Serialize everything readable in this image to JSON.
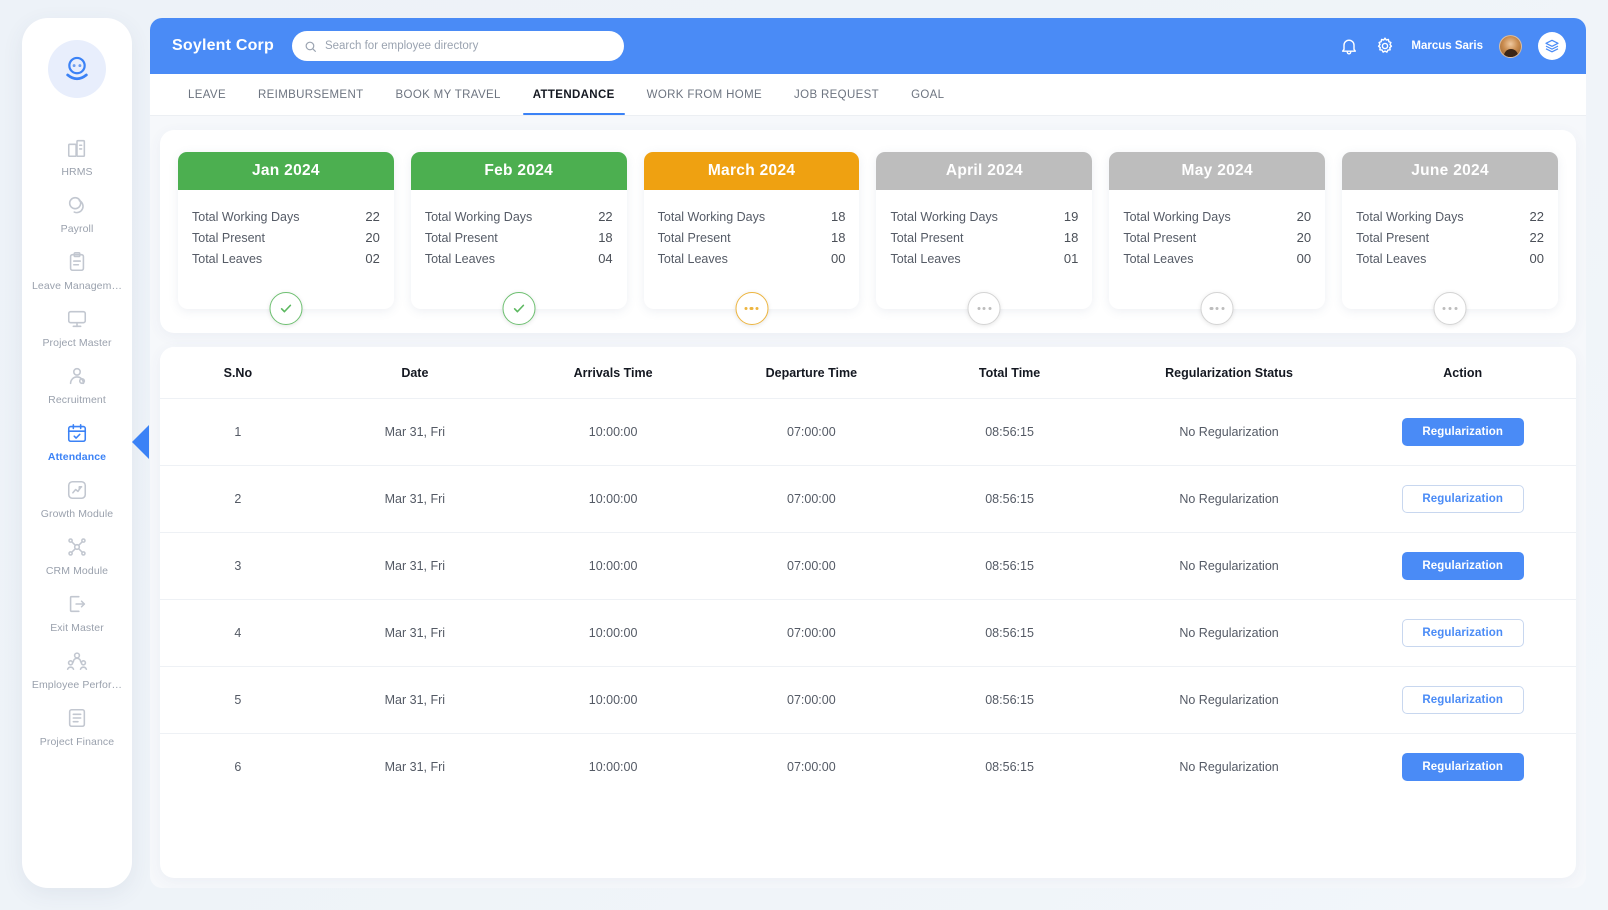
{
  "sidebar": {
    "logo_icon": "robot-avatar-logo",
    "items": [
      {
        "label": "HRMS",
        "icon": "buildings-icon",
        "active": false
      },
      {
        "label": "Payroll",
        "icon": "coins-icon",
        "active": false
      },
      {
        "label": "Leave Managem…",
        "icon": "clipboard-icon",
        "active": false
      },
      {
        "label": "Project Master",
        "icon": "monitor-icon",
        "active": false
      },
      {
        "label": "Recruitment",
        "icon": "user-search-icon",
        "active": false
      },
      {
        "label": "Attendance",
        "icon": "calendar-check-icon",
        "active": true
      },
      {
        "label": "Growth Module",
        "icon": "chart-growth-icon",
        "active": false
      },
      {
        "label": "CRM Module",
        "icon": "network-user-icon",
        "active": false
      },
      {
        "label": "Exit Master",
        "icon": "exit-door-icon",
        "active": false
      },
      {
        "label": "Employee Perfor…",
        "icon": "people-group-icon",
        "active": false
      },
      {
        "label": "Project Finance",
        "icon": "file-finance-icon",
        "active": false
      }
    ]
  },
  "topbar": {
    "brand": "Soylent Corp",
    "search_placeholder": "Search for employee directory",
    "search_value": "",
    "search_icon": "search-icon",
    "bell_icon": "bell-icon",
    "gear_icon": "gear-icon",
    "user_name": "Marcus Saris",
    "avatar_icon": "user-avatar",
    "stack_icon": "layers-icon"
  },
  "tabs": [
    {
      "label": "LEAVE",
      "active": false
    },
    {
      "label": "REIMBURSEMENT",
      "active": false
    },
    {
      "label": "BOOK MY TRAVEL",
      "active": false
    },
    {
      "label": "ATTENDANCE",
      "active": true
    },
    {
      "label": "WORK FROM HOME",
      "active": false
    },
    {
      "label": "JOB REQUEST",
      "active": false
    },
    {
      "label": "GOAL",
      "active": false
    }
  ],
  "month_cards": {
    "labels": {
      "working_days": "Total Working Days",
      "present": "Total Present",
      "leaves": "Total Leaves"
    },
    "items": [
      {
        "month": "Jan 2024",
        "working_days": "22",
        "present": "20",
        "leaves": "02",
        "theme": "green",
        "status_icon": "check-icon",
        "accent": "#4caf50"
      },
      {
        "month": "Feb 2024",
        "working_days": "22",
        "present": "18",
        "leaves": "04",
        "theme": "green",
        "status_icon": "check-icon",
        "accent": "#4caf50"
      },
      {
        "month": "March 2024",
        "working_days": "18",
        "present": "18",
        "leaves": "00",
        "theme": "orange",
        "status_icon": "ellipsis-icon",
        "accent": "#efa111"
      },
      {
        "month": "April 2024",
        "working_days": "19",
        "present": "18",
        "leaves": "01",
        "theme": "grey",
        "status_icon": "ellipsis-icon",
        "accent": "#bdbdbd"
      },
      {
        "month": "May 2024",
        "working_days": "20",
        "present": "20",
        "leaves": "00",
        "theme": "grey",
        "status_icon": "ellipsis-icon",
        "accent": "#bdbdbd"
      },
      {
        "month": "June 2024",
        "working_days": "22",
        "present": "22",
        "leaves": "00",
        "theme": "grey",
        "status_icon": "ellipsis-icon",
        "accent": "#bdbdbd"
      }
    ]
  },
  "table": {
    "headers": [
      "S.No",
      "Date",
      "Arrivals Time",
      "Departure Time",
      "Total Time",
      "Regularization Status",
      "Action"
    ],
    "rows": [
      {
        "sno": "1",
        "date": "Mar 31, Fri",
        "arrival": "10:00:00",
        "departure": "07:00:00",
        "total": "08:56:15",
        "status": "No Regularization",
        "action": "Regularization",
        "action_style": "filled"
      },
      {
        "sno": "2",
        "date": "Mar 31, Fri",
        "arrival": "10:00:00",
        "departure": "07:00:00",
        "total": "08:56:15",
        "status": "No Regularization",
        "action": "Regularization",
        "action_style": "outline"
      },
      {
        "sno": "3",
        "date": "Mar 31, Fri",
        "arrival": "10:00:00",
        "departure": "07:00:00",
        "total": "08:56:15",
        "status": "No Regularization",
        "action": "Regularization",
        "action_style": "filled"
      },
      {
        "sno": "4",
        "date": "Mar 31, Fri",
        "arrival": "10:00:00",
        "departure": "07:00:00",
        "total": "08:56:15",
        "status": "No Regularization",
        "action": "Regularization",
        "action_style": "outline"
      },
      {
        "sno": "5",
        "date": "Mar 31, Fri",
        "arrival": "10:00:00",
        "departure": "07:00:00",
        "total": "08:56:15",
        "status": "No Regularization",
        "action": "Regularization",
        "action_style": "outline"
      },
      {
        "sno": "6",
        "date": "Mar 31, Fri",
        "arrival": "10:00:00",
        "departure": "07:00:00",
        "total": "08:56:15",
        "status": "No Regularization",
        "action": "Regularization",
        "action_style": "filled"
      }
    ]
  },
  "colors": {
    "primary_blue": "#4a8bf6",
    "green": "#4caf50",
    "orange": "#efa111",
    "grey": "#bdbdbd",
    "page_bg": "#eef2f7"
  }
}
